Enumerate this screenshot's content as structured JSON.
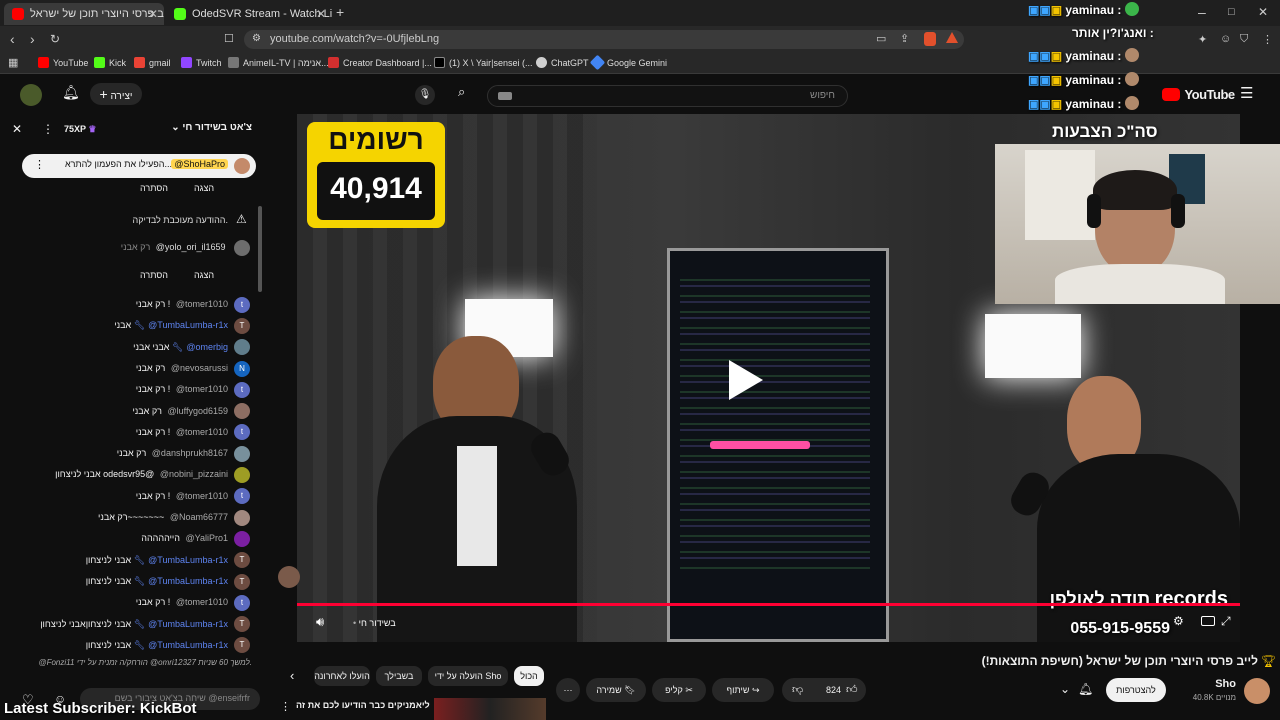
{
  "browser": {
    "tabs": [
      {
        "title": "לייב פרסי היוצרי תוכן של ישראל",
        "active": true
      },
      {
        "title": "OdedSVR Stream - Watch Live on Kic",
        "active": false
      }
    ],
    "url": "youtube.com/watch?v=-0UfjlebLng",
    "bookmarks": [
      "YouTube",
      "Kick",
      "gmail",
      "Twitch",
      "AnimeIL-TV | אנימה...",
      "Creator Dashboard |...",
      "(1) X \\ Yair|sensei (...",
      "ChatGPT",
      "Google Gemini"
    ]
  },
  "youtube": {
    "logo_text": "YouTube",
    "search_placeholder": "חיפוש",
    "create_label": "יצירה"
  },
  "chat": {
    "header_title": "צ'אט בשידור חי",
    "xp_badge": "75XP",
    "pinned": {
      "user": "@ShoHaPro",
      "text": "הפעילו את הפעמון להתרא..."
    },
    "show_label": "הצגה",
    "hide_label": "הסתרה",
    "flagged_text": "ההודעה מעוכבת לבדיקה.",
    "held": {
      "user": "@yolo_ori_il1659",
      "text": "רק אבני"
    },
    "messages": [
      {
        "user": "@tomer1010",
        "text": "רק אבני !",
        "avatar": "t",
        "color": "#5c6bc0"
      },
      {
        "user": "@TumbaLumba-r1x",
        "text": "אבני",
        "avatar": "T",
        "color": "#6d4c41",
        "wrench": true
      },
      {
        "user": "@omerbig",
        "text": "אבני אבני",
        "avatar": "",
        "color": "#607d8b",
        "wrench": true
      },
      {
        "user": "@nevosarussi",
        "text": "רק אבני",
        "avatar": "N",
        "color": "#1565c0"
      },
      {
        "user": "@tomer1010",
        "text": "רק אבני !",
        "avatar": "t",
        "color": "#5c6bc0"
      },
      {
        "user": "@luffygod6159",
        "text": "רק אבני",
        "avatar": "",
        "color": "#8d6e63"
      },
      {
        "user": "@tomer1010",
        "text": "רק אבני !",
        "avatar": "t",
        "color": "#5c6bc0"
      },
      {
        "user": "@danshprukh8167",
        "text": "רק אבני",
        "avatar": "",
        "color": "#78909c"
      },
      {
        "user": "@nobini_pizzaini",
        "text": "אבני לניצחון odedsvr95@",
        "avatar": "",
        "color": "#9e9d24"
      },
      {
        "user": "@tomer1010",
        "text": "רק אבני !",
        "avatar": "t",
        "color": "#5c6bc0"
      },
      {
        "user": "@Noam66777",
        "text": "רק אבני~~~~~~~",
        "avatar": "",
        "color": "#a1887f"
      },
      {
        "user": "@YaliPro1",
        "text": "הייההההה",
        "avatar": "",
        "color": "#7b1fa2"
      },
      {
        "user": "@TumbaLumba-r1x",
        "text": "אבני לניצחון",
        "avatar": "T",
        "color": "#6d4c41",
        "wrench": true
      },
      {
        "user": "@TumbaLumba-r1x",
        "text": "אבני לניצחון",
        "avatar": "T",
        "color": "#6d4c41",
        "wrench": true
      },
      {
        "user": "@tomer1010",
        "text": "רק אבני !",
        "avatar": "t",
        "color": "#5c6bc0"
      },
      {
        "user": "@TumbaLumba-r1x",
        "text": "אבני לניצחוןאבני לניצחון",
        "avatar": "T",
        "color": "#6d4c41",
        "wrench": true
      },
      {
        "user": "@TumbaLumba-r1x",
        "text": "אבני לניצחון",
        "avatar": "T",
        "color": "#6d4c41",
        "wrench": true
      }
    ],
    "timeout_notice": "@Fonzi11 הורחק/ה זמנית על ידי @omri12327 למשך 60 שניות.",
    "input_placeholder": "שיחה בצ'אט ציבורי בשם @enseifrfr",
    "latest_subscriber": "Latest Subscriber: KickBot"
  },
  "overlays": {
    "registered_label": "רשומים",
    "registered_count": "40,914",
    "total_votes_label": "סה\"כ הצבעות",
    "thanks_text": "תודה לאולפן",
    "records_text": "records",
    "phone_text": "055-915-9559",
    "tiktok_rows": [
      {
        "user": "yaminau",
        "text": ":"
      },
      {
        "user": "yaminau",
        "text": ":"
      },
      {
        "user": "yaminau",
        "text": ":"
      },
      {
        "user": "yaminau",
        "text": ":"
      }
    ],
    "stream_title_over": "ואנג'ו?ין אותר :"
  },
  "player": {
    "live_label": "בשידור חי",
    "progress": 1.0
  },
  "video_meta": {
    "title": "לייב פרסי היוצרי תוכן של ישראל (חשיפת התוצאות!)",
    "channel_name": "Sho",
    "subscribers": "40.8K מנויים",
    "subscribe_label": "להצטרפות",
    "likes": "824",
    "share_label": "שיתוף",
    "clip_label": "קליפ",
    "save_label": "שמירה",
    "chips": [
      "הכול",
      "הועלה על ידי Sho",
      "בשבילך",
      "הועלו לאחרונה"
    ],
    "next_video": "מליאמניקים כבר הודיעו לכם את זה?"
  },
  "colors": {
    "accent_red": "#ff0033",
    "overlay_yellow": "#f5d400",
    "link_blue": "#3ea6ff"
  }
}
